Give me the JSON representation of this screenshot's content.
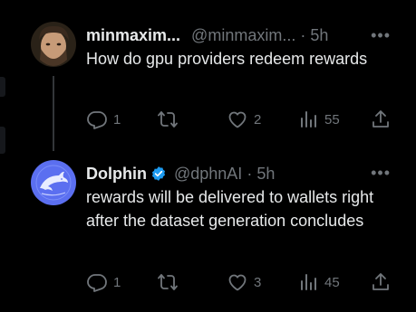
{
  "colors": {
    "background": "#000000",
    "text_primary": "#e7e9ea",
    "text_secondary": "#71767b",
    "verified_blue": "#1d9bf0",
    "thread_line": "#333639"
  },
  "thread": {
    "tweets": [
      {
        "author_display_name": "minmaxim...",
        "author_handle": "@minmaxim...",
        "separator": "·",
        "time": "5h",
        "verified": false,
        "more_icon": "more-horizontal-icon",
        "text": "How do gpu providers redeem rewards",
        "replies": "1",
        "reposts": "",
        "likes": "2",
        "views": "55"
      },
      {
        "author_display_name": "Dolphin",
        "author_handle": "@dphnAI",
        "separator": "·",
        "time": "5h",
        "verified": true,
        "more_icon": "more-horizontal-icon",
        "text": "rewards will be delivered to wallets right after the dataset generation concludes",
        "replies": "1",
        "reposts": "",
        "likes": "3",
        "views": "45"
      }
    ],
    "action_icons": [
      "reply-icon",
      "repost-icon",
      "like-icon",
      "views-icon",
      "share-icon"
    ]
  }
}
